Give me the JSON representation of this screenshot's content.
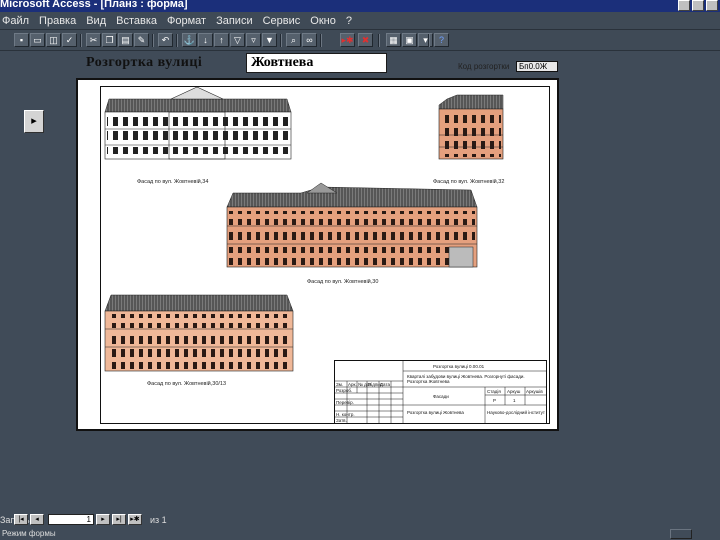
{
  "window": {
    "title": "Microsoft Access - [Планз : форма]"
  },
  "menu": {
    "items": [
      "Файл",
      "Правка",
      "Вид",
      "Вставка",
      "Формат",
      "Записи",
      "Сервис",
      "Окно",
      "?"
    ]
  },
  "toolbar": {
    "buttons": [
      "save-icon",
      "print-icon",
      "preview-icon",
      "spelling-icon",
      "cut-icon",
      "copy-icon",
      "paste-icon",
      "format-painter-icon",
      "undo-icon",
      "hyperlink-icon",
      "sort-asc-icon",
      "sort-desc-icon",
      "filter-selection-icon",
      "filter-form-icon",
      "apply-filter-icon",
      "find-icon",
      "new-record-icon",
      "delete-record-icon",
      "database-window-icon",
      "new-object-icon",
      "help-icon"
    ]
  },
  "form": {
    "title": "Розгортка вулиці",
    "street_value": "Жовтнева",
    "code_label": "Код розгортки",
    "code_value": "Бп0.0Ж"
  },
  "drawing": {
    "captions": [
      "Фасад по вул. Жовтневій,34",
      "Фасад по вул. Жовтневій,32",
      "Фасад по вул. Жовтневій,30",
      "Фасад по вул. Жовтневій,30/13"
    ],
    "titleblock": {
      "sheet_code": "Розгортка вулиці 0.00.01",
      "description": "Кварталі забудови вулиці Жовтнева. Розгорнуті фасади. Розгортка Жовтнева",
      "stage": "Стадія",
      "sheet": "Аркуш",
      "sheets": "Аркушів",
      "stage_value": "Р",
      "sheet_value": "1",
      "label_facade": "Фасади",
      "scale_note": "Розгортка вулиці Жовтнева",
      "org": "Науково-дослідний інститут",
      "row_labels": [
        "Зм.",
        "Арк.",
        "№ док.",
        "Підпис",
        "Дата"
      ],
      "row_left": [
        "Розроб.",
        "Перевір.",
        "Н. контр.",
        "Затв."
      ]
    }
  },
  "navigation": {
    "label": "Запись:",
    "current": "1",
    "total": "из 1"
  },
  "status": {
    "text": "Режим формы"
  },
  "colors": {
    "desktop": "#404b58",
    "titlebar": "#1b2f7a",
    "brick": "#e0906a",
    "roof": "#555555"
  }
}
